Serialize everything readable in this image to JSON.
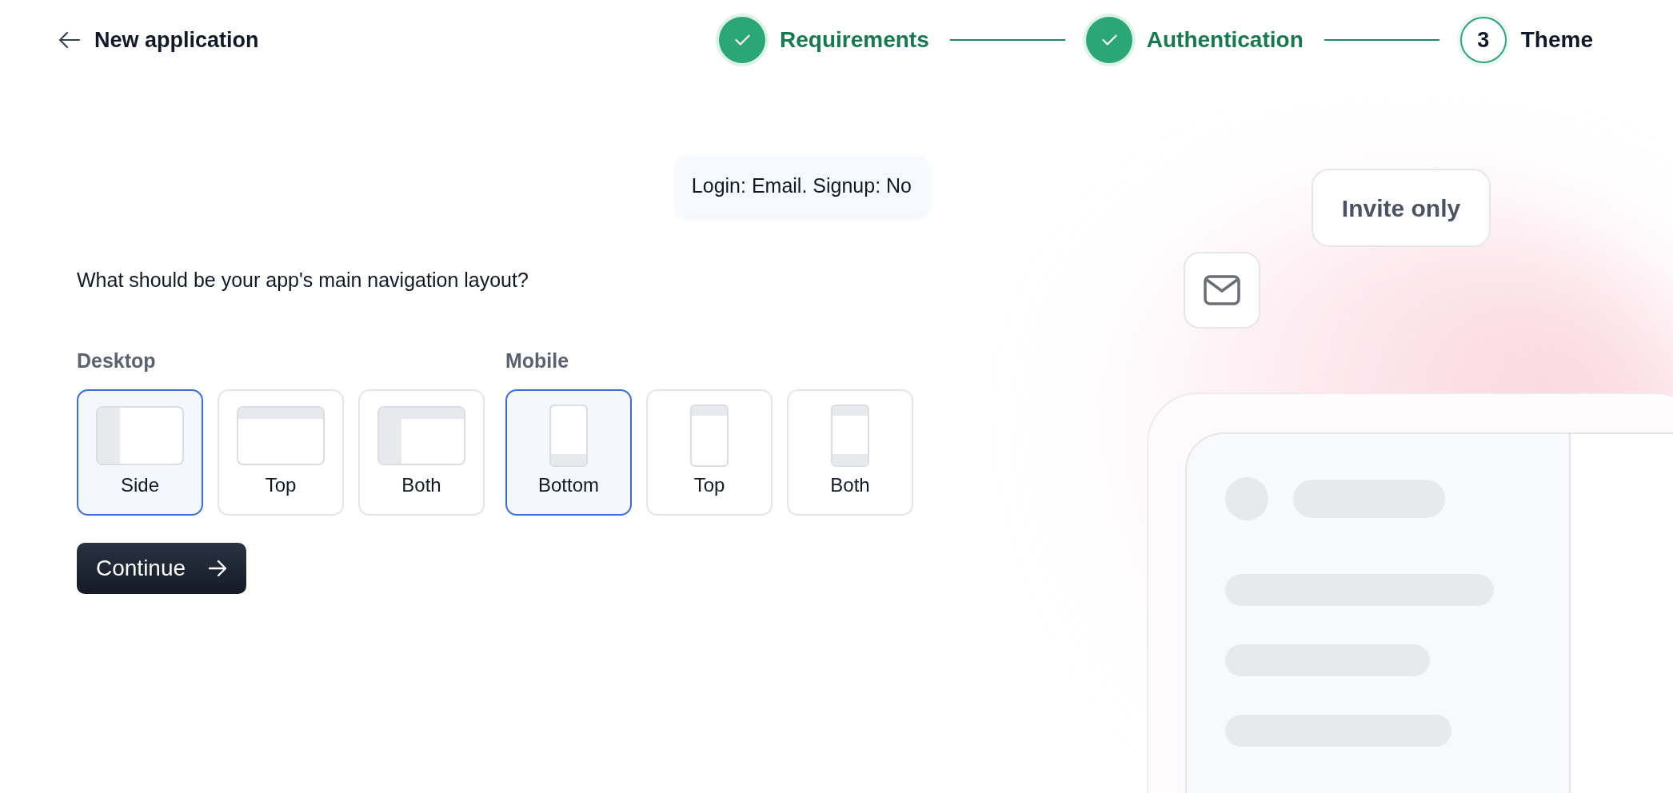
{
  "header": {
    "title": "New application"
  },
  "steps": [
    {
      "label": "Requirements",
      "completed": true
    },
    {
      "label": "Authentication",
      "completed": true
    },
    {
      "label": "Theme",
      "completed": false,
      "number": "3"
    }
  ],
  "summary_chip": "Login: Email. Signup: No",
  "question": "What should be your app's main navigation layout?",
  "groups": [
    {
      "label": "Desktop",
      "kind": "desktop",
      "options": [
        {
          "label": "Side",
          "kind": "side",
          "selected": true
        },
        {
          "label": "Top",
          "kind": "top",
          "selected": false
        },
        {
          "label": "Both",
          "kind": "both",
          "selected": false
        }
      ]
    },
    {
      "label": "Mobile",
      "kind": "mobile",
      "options": [
        {
          "label": "Bottom",
          "kind": "bottom",
          "selected": true
        },
        {
          "label": "Top",
          "kind": "top",
          "selected": false
        },
        {
          "label": "Both",
          "kind": "both",
          "selected": false
        }
      ]
    }
  ],
  "continue_button": "Continue",
  "preview": {
    "invite_card": "Invite only"
  }
}
